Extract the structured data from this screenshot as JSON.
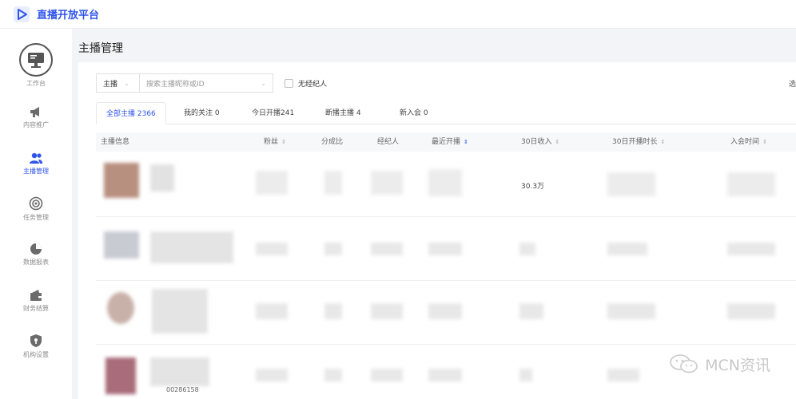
{
  "app": {
    "title": "直播开放平台",
    "accent_color": "#2f54eb",
    "logo_icon": "play-triangle-icon"
  },
  "sidebar": {
    "items": [
      {
        "label": "工作台",
        "icon": "monitor-icon",
        "active": false
      },
      {
        "label": "内容推广",
        "icon": "megaphone-icon",
        "active": false
      },
      {
        "label": "主播管理",
        "icon": "users-icon",
        "active": true
      },
      {
        "label": "任务管理",
        "icon": "target-icon",
        "active": false
      },
      {
        "label": "数据报表",
        "icon": "pie-chart-icon",
        "active": false
      },
      {
        "label": "财务结算",
        "icon": "wallet-icon",
        "active": false
      },
      {
        "label": "机构设置",
        "icon": "shield-icon",
        "active": false
      }
    ]
  },
  "page": {
    "title": "主播管理"
  },
  "filters": {
    "type_select_value": "主播",
    "search_placeholder": "搜索主播昵称或ID",
    "checkbox_label": "无经纪人",
    "edge_text": "选"
  },
  "tabs": [
    {
      "label": "全部主播 2366",
      "active": true
    },
    {
      "label": "我的关注 0",
      "active": false
    },
    {
      "label": "今日开播241",
      "active": false
    },
    {
      "label": "断播主播 4",
      "active": false
    },
    {
      "label": "新入会 0",
      "active": false
    }
  ],
  "table": {
    "columns": [
      {
        "label": "主播信息",
        "sortable": false
      },
      {
        "label": "粉丝",
        "sortable": true
      },
      {
        "label": "分成比",
        "sortable": false
      },
      {
        "label": "经纪人",
        "sortable": false
      },
      {
        "label": "最近开播",
        "sortable": true,
        "active_sort": true
      },
      {
        "label": "30日收入",
        "sortable": true
      },
      {
        "label": "30日开播时长",
        "sortable": true
      },
      {
        "label": "入会时间",
        "sortable": true
      }
    ],
    "rows": [
      {
        "income": "30.3万",
        "id_fragment": ""
      },
      {
        "income": "",
        "id_fragment": ""
      },
      {
        "income": "",
        "id_fragment": ""
      },
      {
        "income": "",
        "id_fragment": "00286158"
      }
    ],
    "sort_icon": "sort-arrows-icon"
  },
  "watermark": {
    "text": "MCN资讯",
    "icon": "wechat-icon"
  }
}
